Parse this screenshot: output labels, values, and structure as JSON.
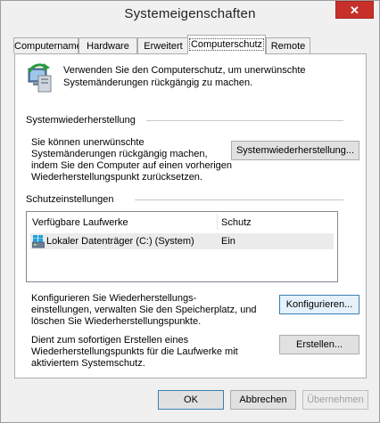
{
  "window": {
    "title": "Systemeigenschaften",
    "close_glyph": "✕"
  },
  "tabs": [
    {
      "label": "Computername"
    },
    {
      "label": "Hardware"
    },
    {
      "label": "Erweitert"
    },
    {
      "label": "Computerschutz"
    },
    {
      "label": "Remote"
    }
  ],
  "intro": {
    "icon": "computer-protection-icon",
    "line1": "Verwenden Sie den Computerschutz, um unerwünschte",
    "line2": "Systemänderungen rückgängig zu machen."
  },
  "restore": {
    "heading": "Systemwiederherstellung",
    "line1": "Sie können unerwünschte",
    "line2": "Systemänderungen rückgängig machen,",
    "line3": "indem Sie den Computer auf einen vorherigen",
    "line4": "Wiederherstellungspunkt zurücksetzen.",
    "button_label": "Systemwiederherstellung..."
  },
  "protection": {
    "heading": "Schutzeinstellungen",
    "columns": {
      "drive": "Verfügbare Laufwerke",
      "protection": "Schutz"
    },
    "rows": [
      {
        "icon": "drive-icon",
        "drive": "Lokaler Datenträger (C:) (System)",
        "protection": "Ein"
      }
    ],
    "configure_text": {
      "line1": "Konfigurieren Sie Wiederherstellungs-",
      "line2": "einstellungen, verwalten Sie den Speicherplatz, und",
      "line3": "löschen Sie Wiederherstellungspunkte."
    },
    "configure_button": "Konfigurieren...",
    "create_text": {
      "line1": "Dient zum sofortigen Erstellen eines",
      "line2": "Wiederherstellungspunkts für die Laufwerke mit",
      "line3": "aktiviertem Systemschutz."
    },
    "create_button": "Erstellen..."
  },
  "footer": {
    "ok": "OK",
    "cancel": "Abbrechen",
    "apply": "Übernehmen"
  }
}
